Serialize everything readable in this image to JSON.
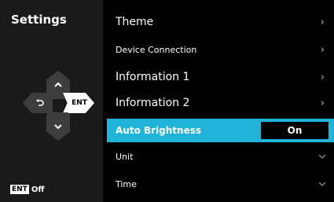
{
  "panel": {
    "title": "Settings",
    "ent_button_label": "ENT",
    "ent_badge": "ENT",
    "ent_status": "Off"
  },
  "menu": {
    "theme": "Theme",
    "device_connection": "Device Connection",
    "information_1": "Information 1",
    "information_2": "Information 2",
    "auto_brightness": "Auto Brightness",
    "auto_brightness_value": "On",
    "unit": "Unit",
    "time": "Time"
  },
  "colors": {
    "highlight": "#1fb4d8",
    "panel_bg": "#1a1a1a",
    "dpad_button": "#3d3d3d"
  },
  "icons": {
    "up": "chevron-up-icon",
    "down": "chevron-down-icon",
    "back": "back-arrow-icon",
    "submenu": "chevron-right-icon",
    "expand": "chevron-down-icon"
  }
}
